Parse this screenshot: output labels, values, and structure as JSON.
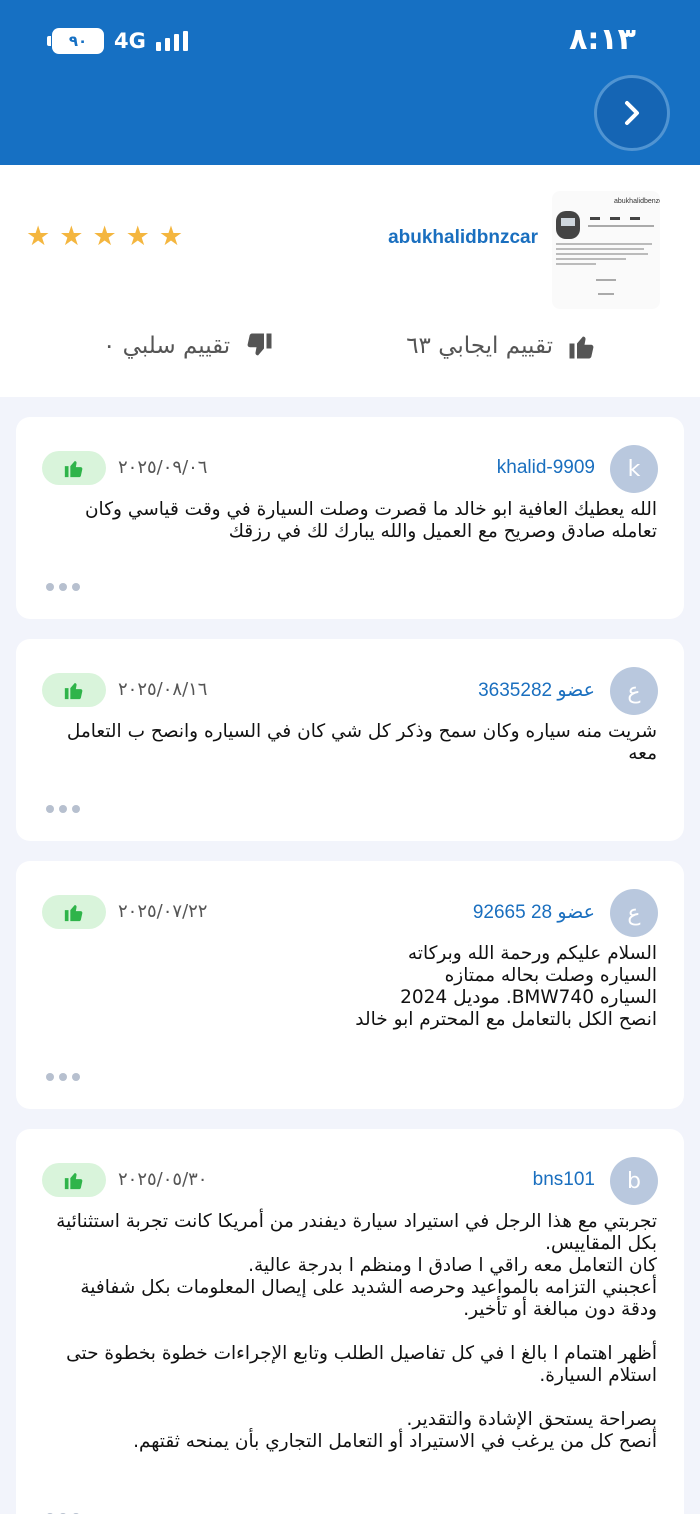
{
  "status_bar": {
    "time": "٨:١٣",
    "battery": "٩٠",
    "network": "4G"
  },
  "profile": {
    "username": "abukhalidbnzcar",
    "stars": 5,
    "positive_label": "تقييم ايجابي ٦٣",
    "negative_label": "تقييم سلبي ٠",
    "thumb_handle": "abukhalidbenzcars"
  },
  "reviews": [
    {
      "avatar_letter": "k",
      "name": "khalid-9909",
      "date": "٢٠٢٥/٠٩/٠٦",
      "text": "الله يعطيك العافية ابو خالد ما قصرت وصلت السيارة في وقت قياسي وكان تعامله صادق وصريح مع العميل والله يبارك لك في رزقك"
    },
    {
      "avatar_letter": "ع",
      "name": "عضو 3635282",
      "date": "٢٠٢٥/٠٨/١٦",
      "text": "شريت منه سياره وكان سمح وذكر كل شي كان في السياره وانصح ب التعامل معه"
    },
    {
      "avatar_letter": "ع",
      "name": "عضو 28 92665",
      "date": "٢٠٢٥/٠٧/٢٢",
      "text": "السلام عليكم ورحمة الله وبركاته\nالسياره وصلت بحاله ممتازه\nالسياره BMW740. موديل 2024\nانصح الكل بالتعامل مع المحترم ابو خالد"
    },
    {
      "avatar_letter": "b",
      "name": "bns101",
      "date": "٢٠٢٥/٠٥/٣٠",
      "text": "تجربتي مع هذا الرجل في استيراد سيارة ديفندر من أمريكا كانت تجربة استثنائية بكل المقاييس.\nكان التعامل معه راقي ا صادق ا ومنظم ا بدرجة عالية.\nأعجبني التزامه بالمواعيد وحرصه الشديد على إيصال المعلومات بكل شفافية ودقة دون مبالغة أو تأخير.\n\nأظهر اهتمام ا بالغ ا في كل تفاصيل الطلب وتابع الإجراءات خطوة بخطوة حتى استلام السيارة.\n\nبصراحة يستحق الإشادة والتقدير.\nأنصح كل من يرغب في الاستيراد أو التعامل التجاري بأن يمنحه ثقتهم."
    }
  ],
  "colors": {
    "header": "#1670c3",
    "link": "#1a6fbf",
    "star": "#f4b63f",
    "like_bg": "#d9f4db",
    "like_fg": "#2fb44a"
  }
}
